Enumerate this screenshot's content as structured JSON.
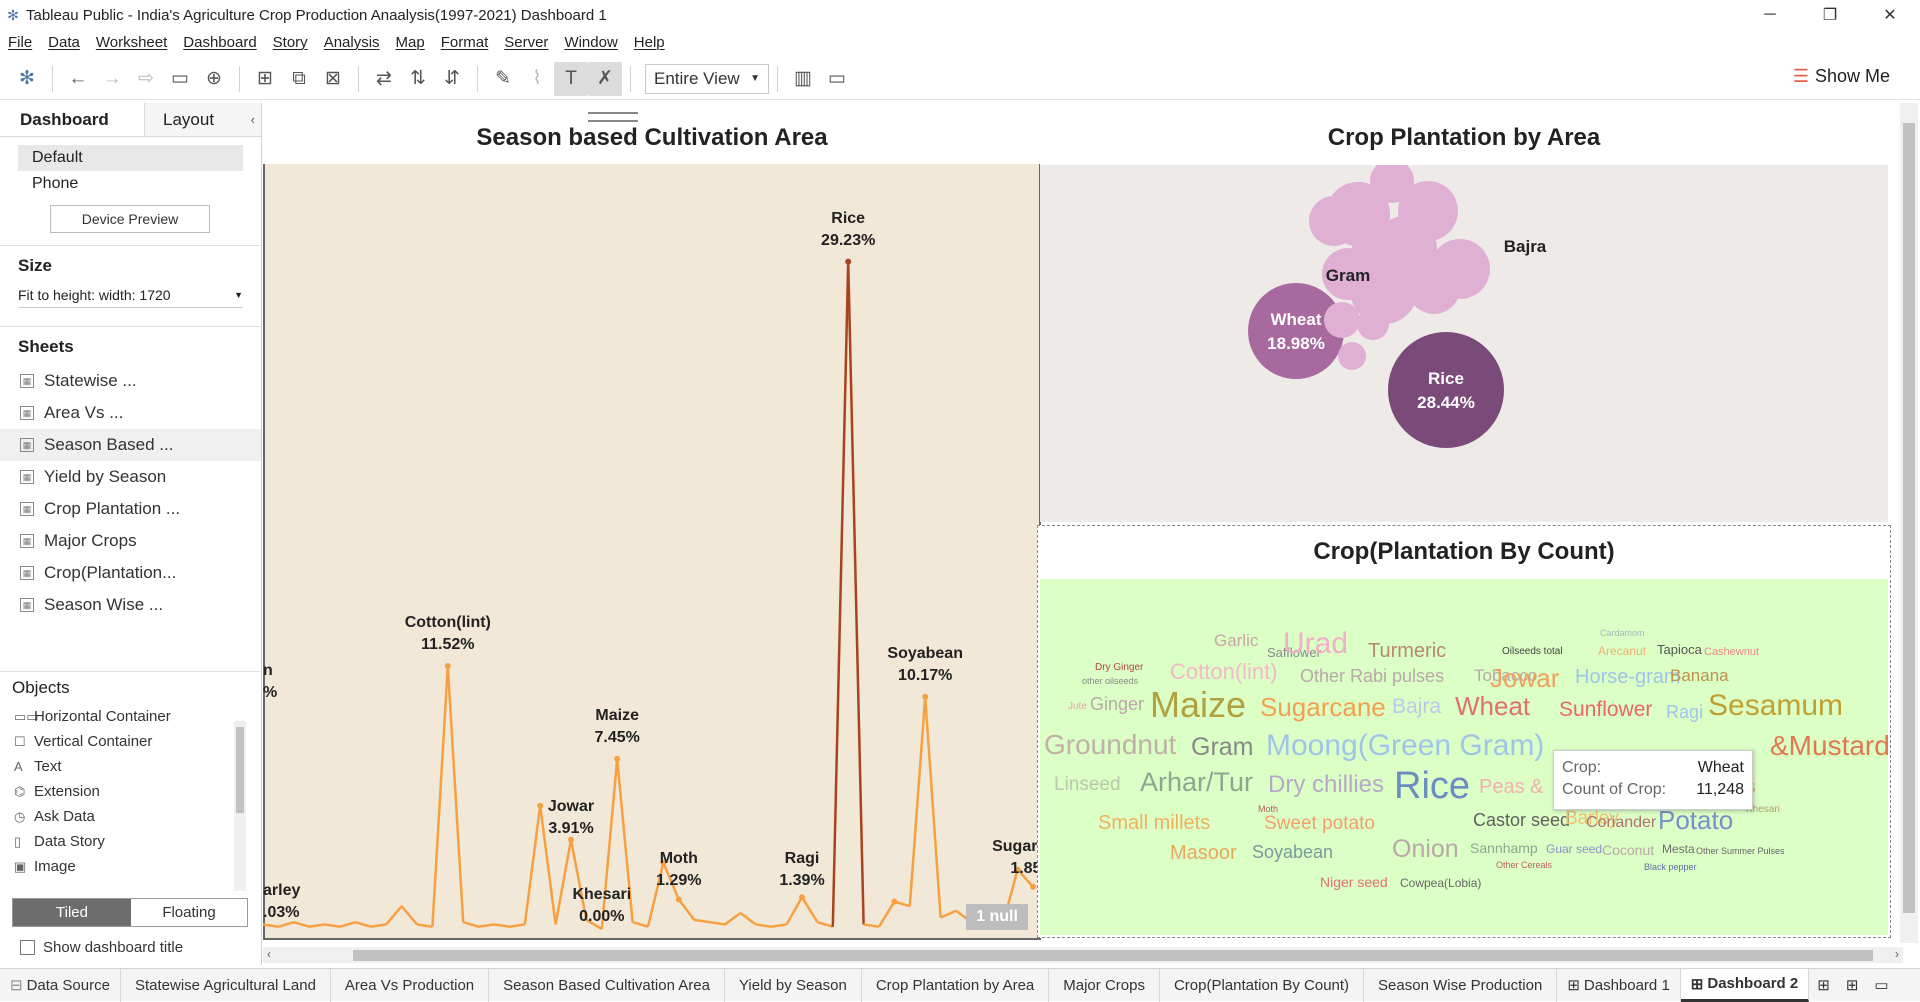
{
  "window": {
    "title": "Tableau Public - India's Agriculture Crop Production Anaalysis(1997-2021) Dashboard 1"
  },
  "menu": [
    "File",
    "Data",
    "Worksheet",
    "Dashboard",
    "Story",
    "Analysis",
    "Map",
    "Format",
    "Server",
    "Window",
    "Help"
  ],
  "toolbar": {
    "view_select": "Entire View",
    "show_me": "Show Me"
  },
  "left_panel": {
    "tab_dashboard": "Dashboard",
    "tab_layout": "Layout",
    "devices": [
      "Default",
      "Phone"
    ],
    "device_preview": "Device Preview",
    "size_heading": "Size",
    "size_value": "Fit to height: width: 1720",
    "sheets_heading": "Sheets",
    "sheets": [
      "Statewise ...",
      "Area Vs ...",
      "Season Based ...",
      "Yield by Season",
      "Crop Plantation ...",
      "Major Crops",
      "Crop(Plantation...",
      "Season Wise ..."
    ],
    "objects_heading": "Objects",
    "objects": [
      {
        "label": "Horizontal Container",
        "icon": "horizontal-container-icon"
      },
      {
        "label": "Vertical Container",
        "icon": "vertical-container-icon"
      },
      {
        "label": "Text",
        "icon": "text-icon"
      },
      {
        "label": "Extension",
        "icon": "extension-icon"
      },
      {
        "label": "Ask Data",
        "icon": "ask-data-icon"
      },
      {
        "label": "Data Story",
        "icon": "data-story-icon"
      },
      {
        "label": "Image",
        "icon": "image-icon"
      }
    ],
    "tiled": "Tiled",
    "floating": "Floating",
    "show_title": "Show dashboard title"
  },
  "panel_line": {
    "title": "Season based Cultivation Area",
    "null_badge": "1 null",
    "labels": [
      {
        "name": "arley",
        "value": ".03%"
      },
      {
        "name": "Cotton(lint)",
        "value": "11.52%"
      },
      {
        "name": "Jowar",
        "value": "3.91%"
      },
      {
        "name": "Khesari",
        "value": "0.00%"
      },
      {
        "name": "Maize",
        "value": "7.45%"
      },
      {
        "name": "Moth",
        "value": "1.29%"
      },
      {
        "name": "Ragi",
        "value": "1.39%"
      },
      {
        "name": "Rice",
        "value": "29.23%"
      },
      {
        "name": "Soyabean",
        "value": "10.17%"
      },
      {
        "name": "Sugarcane",
        "value": "1.85%"
      },
      {
        "name": "n",
        "value": "%"
      }
    ]
  },
  "chart_data": [
    {
      "type": "line",
      "title": "Season based Cultivation Area",
      "series": [
        {
          "values": [
            0.2,
            0.1,
            0.3,
            0.1,
            0.2,
            0.1,
            0.3,
            0.1,
            0.2,
            1.0,
            0.2,
            0.1,
            11.52,
            0.3,
            0.1,
            0.2,
            0.1,
            0.2,
            5.4,
            0.2,
            3.91,
            0.4,
            0.0,
            7.45,
            0.3,
            0.1,
            2.9,
            1.29,
            0.4,
            0.3,
            0.2,
            0.7,
            0.2,
            0.1,
            0.2,
            1.39,
            0.3,
            0.1,
            29.23,
            0.2,
            0.1,
            1.2,
            1.0,
            10.17,
            0.5,
            0.8,
            0.3,
            0.2,
            0.1,
            2.6,
            1.85
          ]
        }
      ],
      "ylim": [
        0,
        30
      ]
    },
    {
      "type": "scatter",
      "title": "Crop Plantation by Area",
      "series": [
        {
          "name": "Rice",
          "values": [
            28.44
          ]
        },
        {
          "name": "Wheat",
          "values": [
            18.98
          ]
        },
        {
          "name": "Bajra",
          "values": [
            5.0
          ]
        },
        {
          "name": "Gram",
          "values": [
            4.2
          ]
        }
      ]
    },
    {
      "type": "table",
      "title": "Crop(Plantation  By Count)",
      "words": [
        "Garlic",
        "Safflower",
        "Urad",
        "Turmeric",
        "Oilseeds total",
        "Cardamom",
        "Arecanut",
        "Tapioca",
        "Cashewnut",
        "Dry Ginger",
        "other oilseeds",
        "Cotton(lint)",
        "Other Rabi pulses",
        "Tobacco",
        "Jowar",
        "Horse-gram",
        "Banana",
        "Jute",
        "Ginger",
        "Maize",
        "Sugarcane",
        "Bajra",
        "Wheat",
        "Sunflower",
        "Ragi",
        "Sesamum",
        "Groundnut",
        "Gram",
        "Moong(Green Gram)",
        "&Mustard",
        "Linseed",
        "Arhar/Tur",
        "Dry chillies",
        "Rice",
        "Peas &",
        "Kharif pulses",
        "Small millets",
        "Moth",
        "Sweet potato",
        "Castor seed",
        "Barley",
        "Potato",
        "Khesari",
        "Masoor",
        "Soyabean",
        "Onion",
        "Sannhamp",
        "Guar seed",
        "Coconut",
        "Mesta",
        "Coriander",
        "Other Summer Pulses",
        "Other Cereals",
        "Black pepper",
        "Niger seed",
        "Cowpea(Lobia)"
      ]
    }
  ],
  "bubble_labels": [
    {
      "name": "Rice",
      "value": "28.44%"
    },
    {
      "name": "Wheat",
      "value": "18.98%"
    },
    {
      "name": "Bajra",
      "value": ""
    },
    {
      "name": "Gram",
      "value": ""
    }
  ],
  "panel_bubble": {
    "title": "Crop Plantation by Area"
  },
  "panel_words": {
    "title": "Crop(Plantation  By Count)"
  },
  "tooltip": {
    "crop_key": "Crop:",
    "crop_val": "Wheat",
    "count_key": "Count of Crop:",
    "count_val": "11,248"
  },
  "bottom_tabs": [
    "Data Source",
    "Statewise Agricultural Land",
    "Area Vs Production",
    "Season Based Cultivation Area",
    "Yield by Season",
    "Crop Plantation by Area",
    "Major Crops",
    "Crop(Plantation By Count)",
    "Season Wise Production",
    "Dashboard 1",
    "Dashboard 2"
  ],
  "colors": {
    "line": "#f7a041",
    "line_peak": "#a8431d",
    "bubble_dark": "#7a4a78",
    "bubble_mid": "#a86a9e",
    "bubble_light": "#e0b0d4",
    "wordcloud_bg": "#dcffc6",
    "line_bg": "#f2e8d8"
  }
}
